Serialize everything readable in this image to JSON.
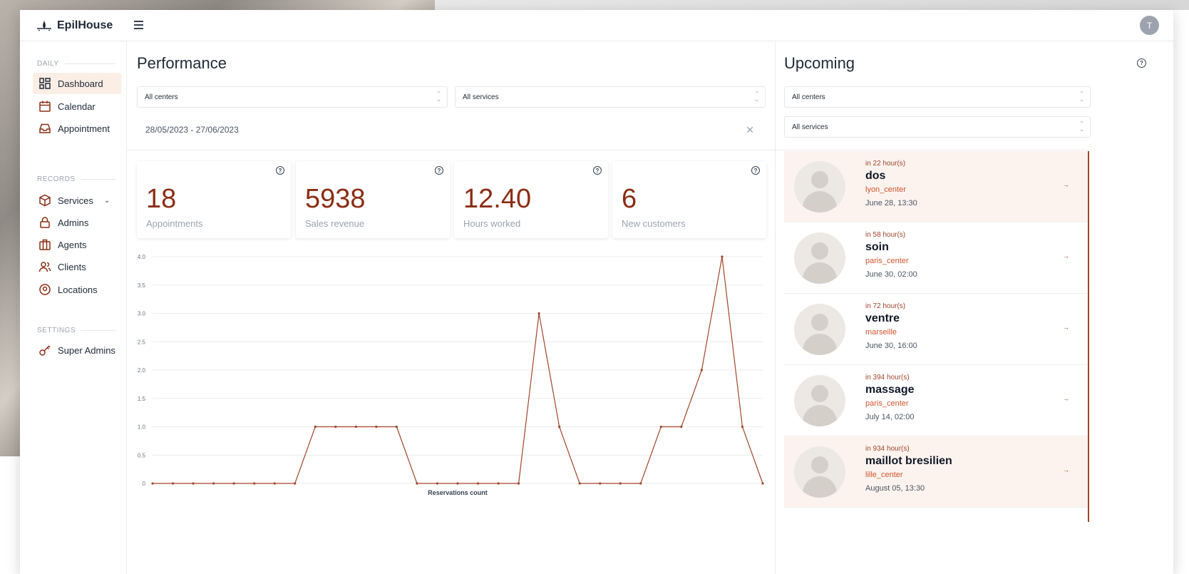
{
  "brand": {
    "name": "EpilHouse"
  },
  "user": {
    "initial": "T"
  },
  "sidebar": {
    "sections": [
      {
        "label": "DAILY"
      },
      {
        "label": "RECORDS"
      },
      {
        "label": "SETTINGS"
      }
    ],
    "items": [
      {
        "label": "Dashboard",
        "icon": "dashboard-icon",
        "active": true
      },
      {
        "label": "Calendar",
        "icon": "calendar-icon"
      },
      {
        "label": "Appointment",
        "icon": "inbox-icon"
      },
      {
        "label": "Services",
        "icon": "box-icon",
        "has_submenu": true
      },
      {
        "label": "Admins",
        "icon": "lock-icon"
      },
      {
        "label": "Agents",
        "icon": "briefcase-icon"
      },
      {
        "label": "Clients",
        "icon": "users-icon"
      },
      {
        "label": "Locations",
        "icon": "location-pin-icon"
      },
      {
        "label": "Super Admins",
        "icon": "key-icon"
      }
    ]
  },
  "performance": {
    "title": "Performance",
    "centers_select": "All centers",
    "services_select": "All services",
    "date_range": "28/05/2023 - 27/06/2023",
    "stats": [
      {
        "value": "18",
        "label": "Appointments"
      },
      {
        "value": "5938",
        "label": "Sales revenue"
      },
      {
        "value": "12.40",
        "label": "Hours worked"
      },
      {
        "value": "6",
        "label": "New customers"
      }
    ]
  },
  "chart_data": {
    "type": "line",
    "title": "",
    "xlabel": "Reservations count",
    "ylabel": "",
    "ylim": [
      0,
      4.0
    ],
    "yticks": [
      "0",
      "0.5",
      "1.0",
      "1.5",
      "2.0",
      "2.5",
      "3.0",
      "3.5",
      "4.0"
    ],
    "grid": true,
    "line_color": "#a0452a",
    "series": [
      {
        "values": [
          0,
          0,
          0,
          0,
          0,
          0,
          0,
          0,
          1,
          1,
          1,
          1,
          1,
          0,
          0,
          0,
          0,
          0,
          0,
          3,
          1,
          0,
          0,
          0,
          0,
          1,
          1,
          2,
          4,
          1,
          0
        ]
      }
    ]
  },
  "upcoming": {
    "title": "Upcoming",
    "centers_select": "All centers",
    "services_select": "All services",
    "items": [
      {
        "eta": "in 22 hour(s)",
        "name": "dos",
        "center": "lyon_center",
        "date": "June 28, 13:30",
        "highlight": true
      },
      {
        "eta": "in 58 hour(s)",
        "name": "soin",
        "center": "paris_center",
        "date": "June 30, 02:00",
        "highlight": false
      },
      {
        "eta": "in 72 hour(s)",
        "name": "ventre",
        "center": "marseille",
        "date": "June 30, 16:00",
        "highlight": false
      },
      {
        "eta": "in 394 hour(s)",
        "name": "massage",
        "center": "paris_center",
        "date": "July 14, 02:00",
        "highlight": false
      },
      {
        "eta": "in 934 hour(s)",
        "name": "maillot bresilien",
        "center": "lille_center",
        "date": "August 05, 13:30",
        "highlight": true
      }
    ]
  },
  "colors": {
    "accent": "#a0452a",
    "stat_value": "#8a2e14",
    "active_bg": "#fbeee4"
  }
}
